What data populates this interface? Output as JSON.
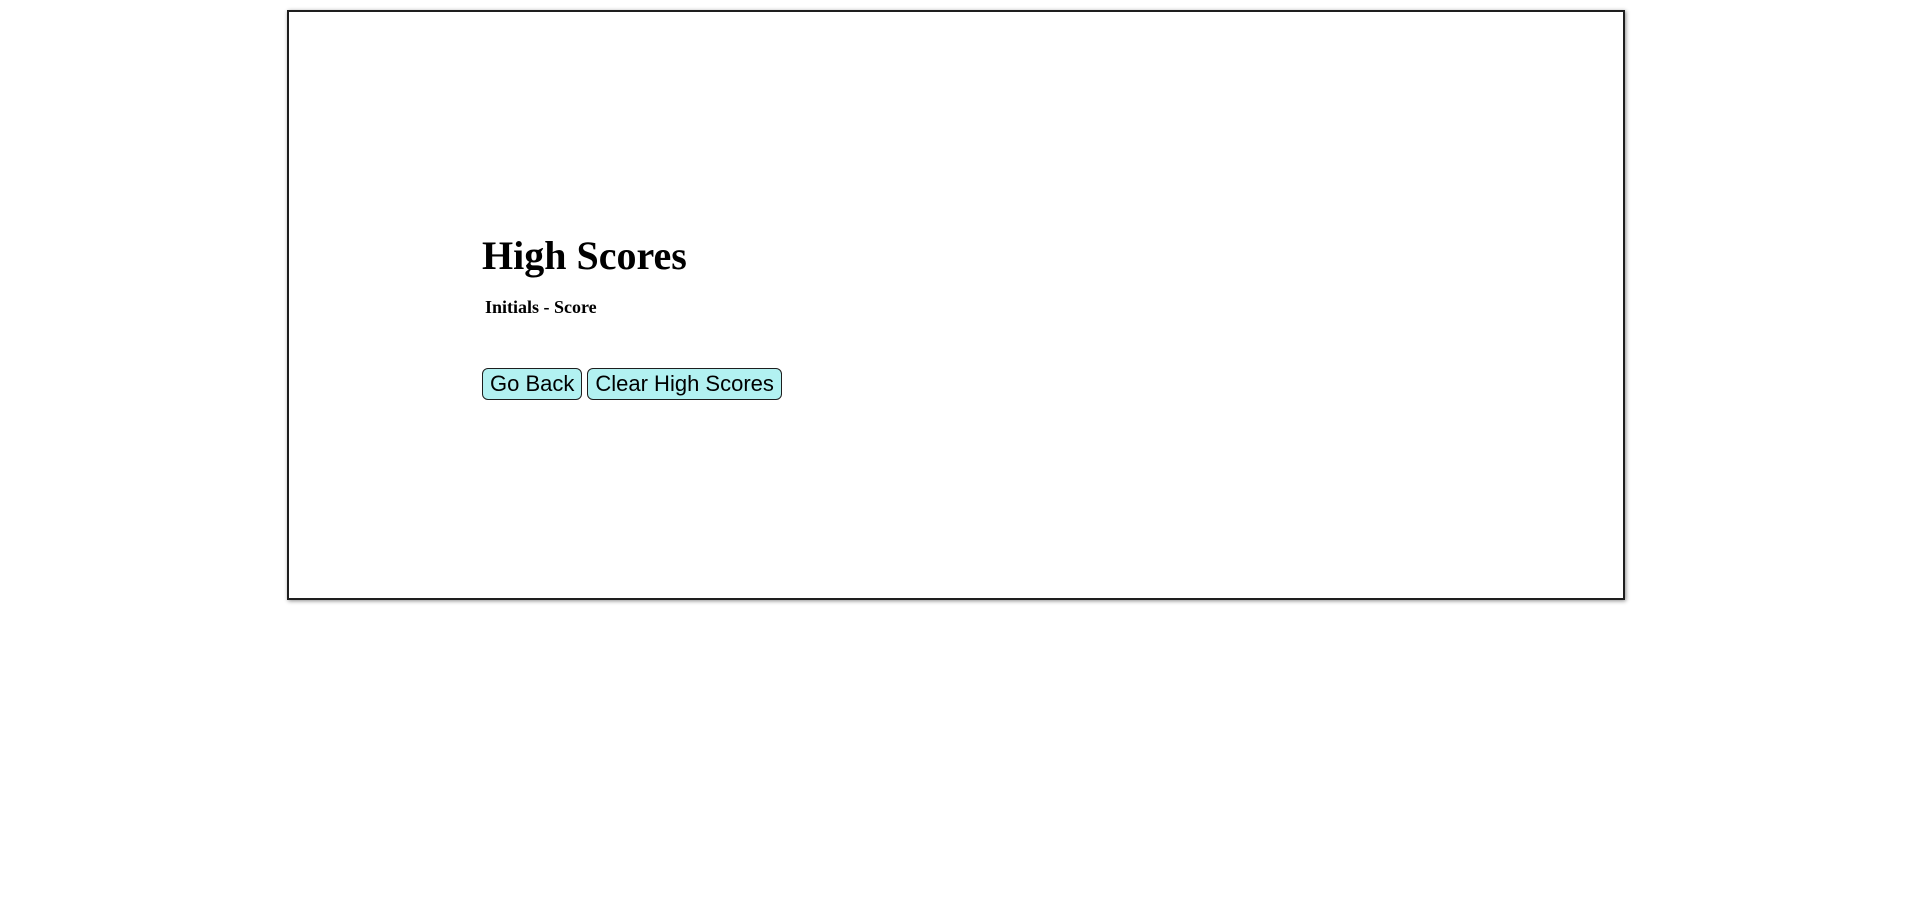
{
  "high_scores": {
    "title": "High Scores",
    "column_header": "Initials - Score",
    "entries": []
  },
  "actions": {
    "go_back_label": "Go Back",
    "clear_label": "Clear High Scores"
  },
  "colors": {
    "button_background": "#b2f1f1",
    "border": "#1e1e1e",
    "text": "#000000",
    "page_background": "#ffffff"
  }
}
